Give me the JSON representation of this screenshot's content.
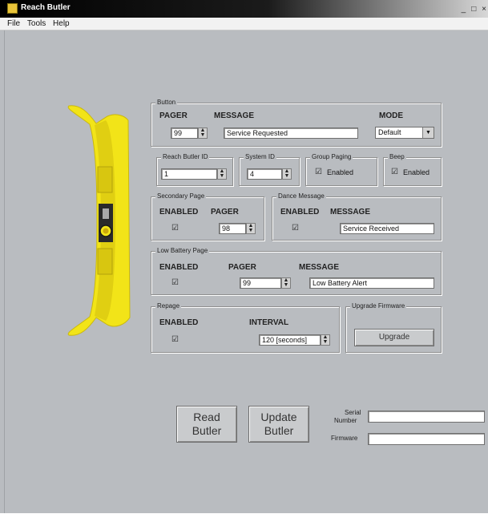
{
  "window": {
    "title": "Reach Butler",
    "min_label": "_",
    "max_label": "□",
    "close_label": "×"
  },
  "menu": {
    "items": [
      "File",
      "Tools",
      "Help"
    ]
  },
  "button_group": {
    "legend": "Button",
    "pager_header": "PAGER",
    "message_header": "MESSAGE",
    "mode_header": "MODE",
    "pager_value": "99",
    "message_value": "Service Requested",
    "mode_value": "Default"
  },
  "reach_group": {
    "legend": "Reach Butler ID",
    "value": "1"
  },
  "system_group": {
    "legend": "System ID",
    "value": "4"
  },
  "group_paging": {
    "legend": "Group Paging",
    "checkbox_label": "Enabled",
    "checked": true
  },
  "beep_group": {
    "legend": "Beep",
    "checkbox_label": "Enabled",
    "checked": true
  },
  "secondary_page": {
    "legend": "Secondary Page",
    "enabled_header": "ENABLED",
    "pager_header": "PAGER",
    "checked": true,
    "pager_value": "98"
  },
  "dance_message": {
    "legend": "Dance Message",
    "enabled_header": "ENABLED",
    "message_header": "MESSAGE",
    "checked": true,
    "message_value": "Service Received"
  },
  "low_battery": {
    "legend": "Low Battery Page",
    "enabled_header": "ENABLED",
    "pager_header": "PAGER",
    "message_header": "MESSAGE",
    "checked": true,
    "pager_value": "99",
    "message_value": "Low Battery Alert"
  },
  "repage": {
    "legend": "Repage",
    "enabled_header": "ENABLED",
    "interval_header": "INTERVAL",
    "checked": true,
    "interval_value": "120 [seconds]"
  },
  "upgrade_firmware": {
    "legend": "Upgrade Firmware",
    "button_label": "Upgrade"
  },
  "actions": {
    "read_line1": "Read",
    "read_line2": "Butler",
    "update_line1": "Update",
    "update_line2": "Butler"
  },
  "info": {
    "serial_line1": "Serial",
    "serial_line2": "Number",
    "firmware_label": "Firmware",
    "serial_value": "",
    "firmware_value": ""
  },
  "colors": {
    "device_yellow": "#f2e418",
    "window_gray": "#b9bcc0",
    "titlebar": "#000000"
  },
  "icons": {
    "app": "app-icon",
    "spin": "spin-arrows-icon",
    "check": "checkmark-icon",
    "dropdown": "dropdown-arrow-icon"
  }
}
